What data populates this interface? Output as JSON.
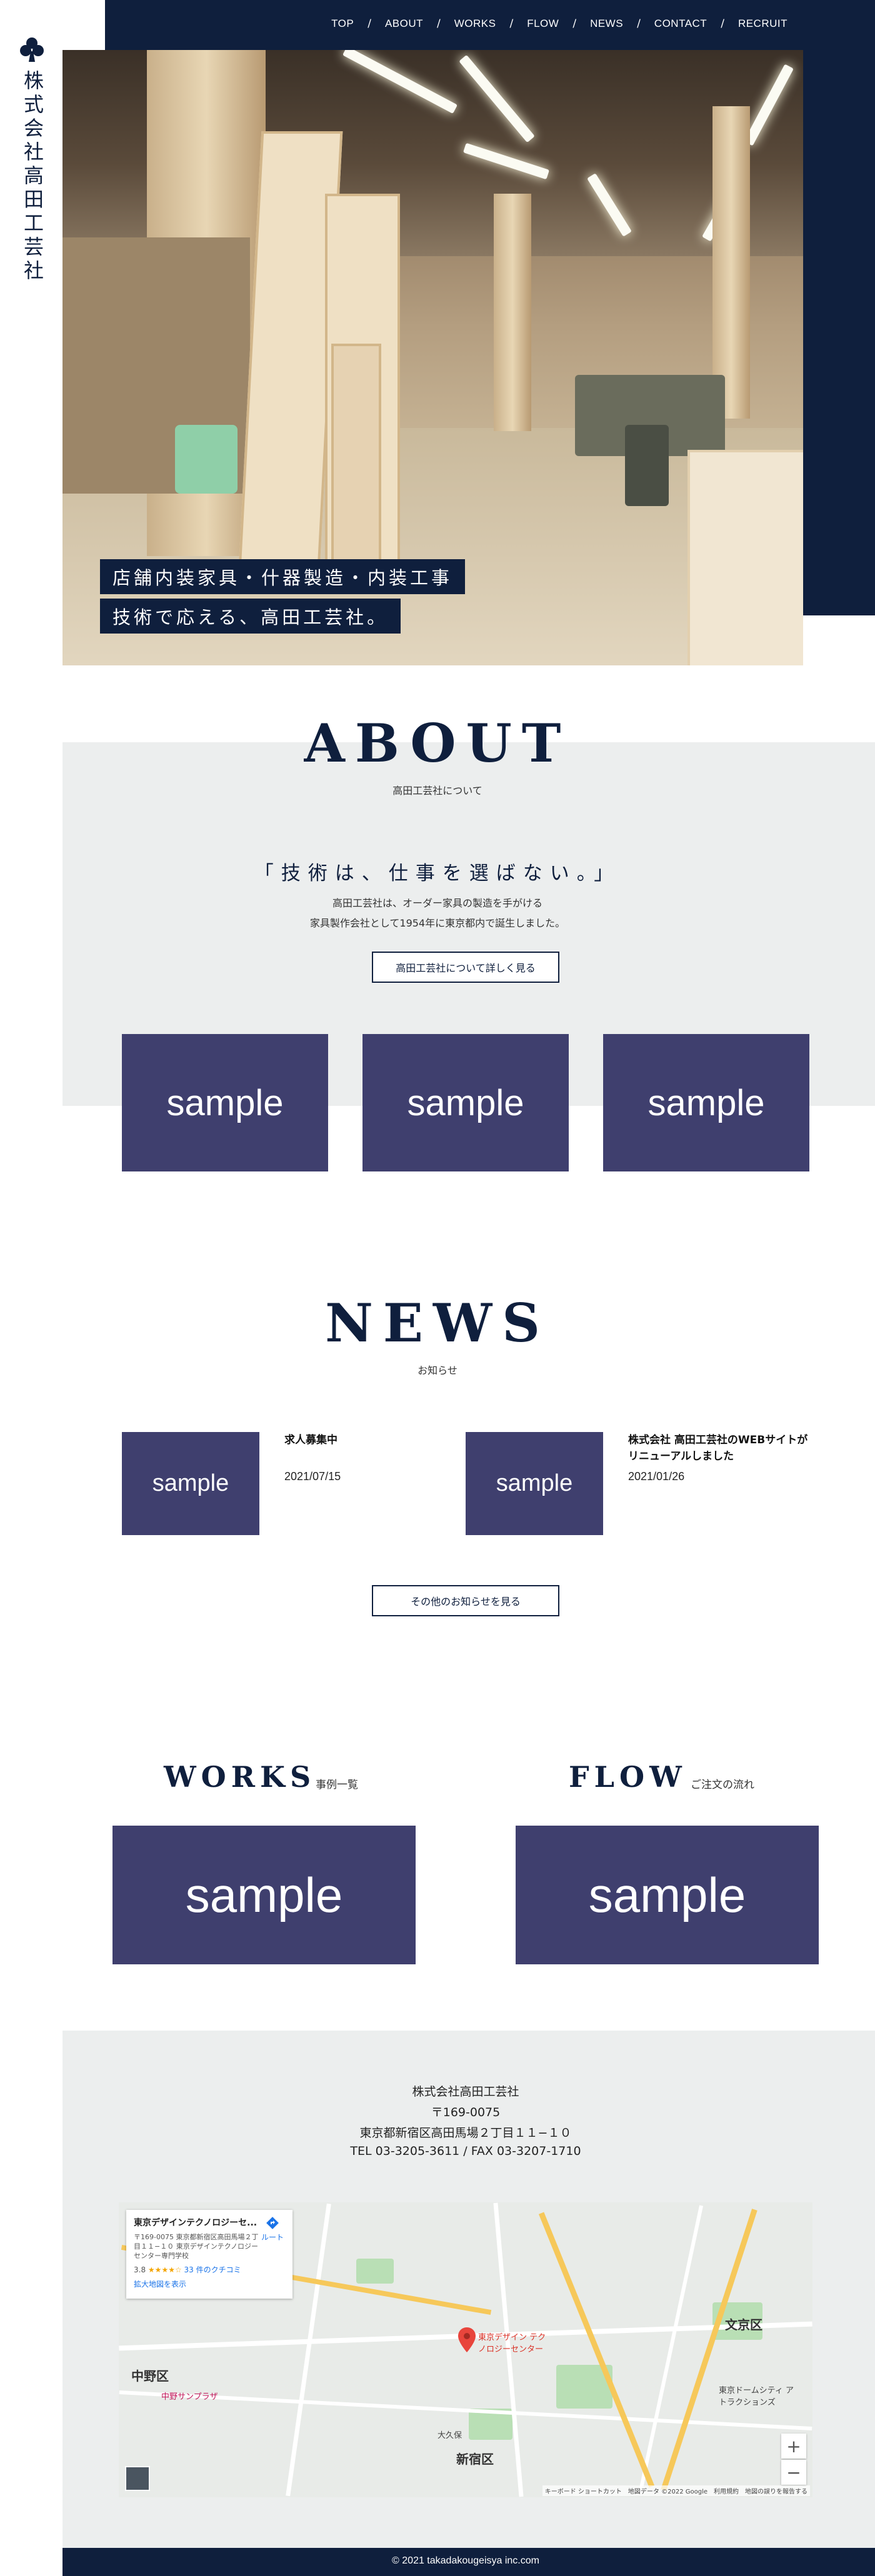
{
  "site": {
    "logo_text": "株式会社高田工芸社"
  },
  "nav": {
    "items": [
      {
        "label": "TOP"
      },
      {
        "label": "ABOUT"
      },
      {
        "label": "WORKS"
      },
      {
        "label": "FLOW"
      },
      {
        "label": "NEWS"
      },
      {
        "label": "CONTACT"
      },
      {
        "label": "RECRUIT"
      }
    ],
    "separator": "/"
  },
  "hero": {
    "caption_line1": "店舗内装家具・什器製造・内装工事",
    "caption_line2": "技術で応える、高田工芸社。"
  },
  "about": {
    "title": "ABOUT",
    "subtitle": "高田工芸社について",
    "catch": "「技術は、仕事を選ばない。」",
    "body_line1": "高田工芸社は、オーダー家具の製造を手がける",
    "body_line2": "家具製作会社として1954年に東京都内で誕生しました。",
    "button_label": "高田工芸社について詳しく見る",
    "samples": [
      "sample",
      "sample",
      "sample"
    ]
  },
  "news": {
    "title": "NEWS",
    "subtitle": "お知らせ",
    "items": [
      {
        "thumb": "sample",
        "title": "求人募集中",
        "date": "2021/07/15"
      },
      {
        "thumb": "sample",
        "title": "株式会社 高田工芸社のWEBサイトがリニューアルしました",
        "date": "2021/01/26"
      }
    ],
    "button_label": "その他のお知らせを見る"
  },
  "works": {
    "title": "WORKS",
    "subtitle": "事例一覧",
    "thumb": "sample"
  },
  "flow": {
    "title": "FLOW",
    "subtitle": "ご注文の流れ",
    "thumb": "sample"
  },
  "company": {
    "name": "株式会社高田工芸社",
    "zip": "〒169-0075",
    "address": "東京都新宿区高田馬場２丁目１１−１０",
    "tel_fax": "TEL 03-3205-3611 / FAX 03-3207-1710"
  },
  "map": {
    "card_title": "東京デザインテクノロジーセ...",
    "card_address": "〒169-0075 東京都新宿区高田馬場２丁目１１−１０ 東京デザインテクノロジーセンター専門学校",
    "rating": "3.8",
    "stars": "★★★★☆",
    "reviews": "33 件のクチコミ",
    "larger_map_link": "拡大地図を表示",
    "route_label": "ルート",
    "labels": [
      "中野区",
      "新宿区",
      "文京区",
      "大久保",
      "中野サンプラザ",
      "東京ドームシティ アトラクションズ",
      "東京デザイン テクノロジーセンター"
    ],
    "zoom_in": "+",
    "zoom_out": "−",
    "attribution": "キーボード ショートカット　地図データ ©2022 Google　利用規約　地図の誤りを報告する",
    "colors": {
      "road": "#ffffff",
      "highway": "#f6c85a",
      "park": "#b9dfb5",
      "pin": "#e8453c"
    }
  },
  "footer": {
    "copyright": "© 2021 takadakougeisya inc.com"
  },
  "colors": {
    "navy": "#0f1f3d",
    "sample": "#3f3f6e",
    "gray_bg": "#eceeee"
  }
}
